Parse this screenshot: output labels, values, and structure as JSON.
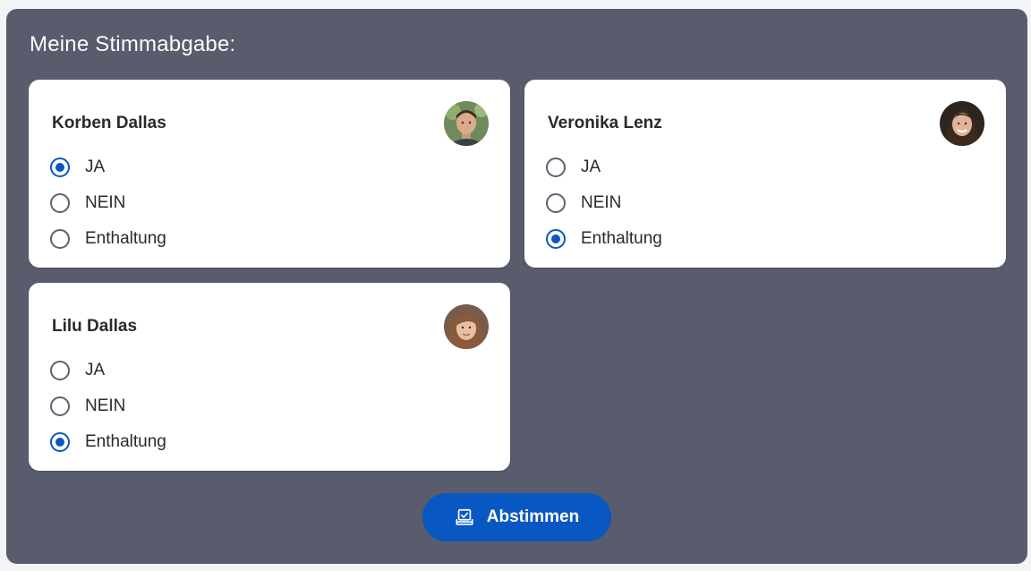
{
  "panel": {
    "title": "Meine Stimmabgabe:",
    "background": "#585c6c"
  },
  "candidates": [
    {
      "name": "Korben Dallas",
      "avatar_icon": "person-avatar",
      "options": [
        "JA",
        "NEIN",
        "Enthaltung"
      ],
      "selected": "JA"
    },
    {
      "name": "Veronika Lenz",
      "avatar_icon": "person-avatar",
      "options": [
        "JA",
        "NEIN",
        "Enthaltung"
      ],
      "selected": "Enthaltung"
    },
    {
      "name": "Lilu Dallas",
      "avatar_icon": "person-avatar",
      "options": [
        "JA",
        "NEIN",
        "Enthaltung"
      ],
      "selected": "Enthaltung"
    }
  ],
  "submit": {
    "label": "Abstimmen",
    "icon": "ballot-box-icon",
    "color": "#0857c3"
  },
  "colors": {
    "accent": "#0857c3",
    "card": "#ffffff",
    "text": "#2a2a2a"
  }
}
